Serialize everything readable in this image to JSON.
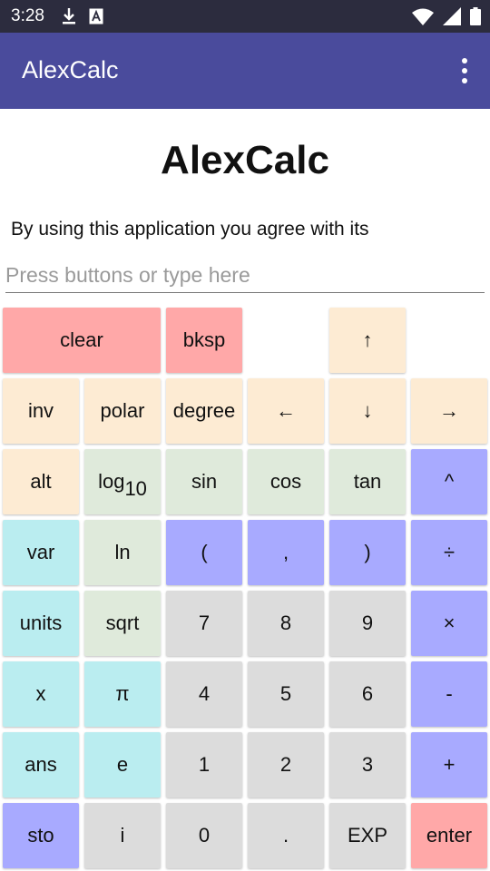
{
  "status": {
    "time": "3:28",
    "icons": [
      "download-icon",
      "font-a-icon",
      "wifi-icon",
      "signal-icon",
      "battery-icon"
    ]
  },
  "app_bar": {
    "title": "AlexCalc",
    "menu_icon": "more-vert-icon"
  },
  "content": {
    "title": "AlexCalc",
    "terms_text": "By using this application you agree with its",
    "input_placeholder": "Press buttons or type here",
    "input_value": ""
  },
  "colors": {
    "status_bar": "#2c2c3e",
    "app_bar": "#4a4b9c",
    "key_red": "#ffa8a8",
    "key_tan": "#fdebd3",
    "key_green": "#dfeadb",
    "key_blue": "#a8aaff",
    "key_cyan": "#baedf0",
    "key_grey": "#dcdcdc"
  },
  "keys": {
    "clear": "clear",
    "bksp": "bksp",
    "up": "↑",
    "inv": "inv",
    "polar": "polar",
    "degree": "degree",
    "left": "←",
    "down": "↓",
    "right": "→",
    "alt": "alt",
    "log": "log",
    "log_base": "10",
    "sin": "sin",
    "cos": "cos",
    "tan": "tan",
    "pow": "^",
    "var": "var",
    "ln": "ln",
    "lparen": "(",
    "comma": ",",
    "rparen": ")",
    "divide": "÷",
    "units": "units",
    "sqrt": "sqrt",
    "seven": "7",
    "eight": "8",
    "nine": "9",
    "multiply": "×",
    "x": "x",
    "pi": "π",
    "four": "4",
    "five": "5",
    "six": "6",
    "minus": "-",
    "ans": "ans",
    "e": "e",
    "one": "1",
    "two": "2",
    "three": "3",
    "plus": "+",
    "sto": "sto",
    "i": "i",
    "zero": "0",
    "dot": ".",
    "exp": "EXP",
    "enter": "enter"
  }
}
